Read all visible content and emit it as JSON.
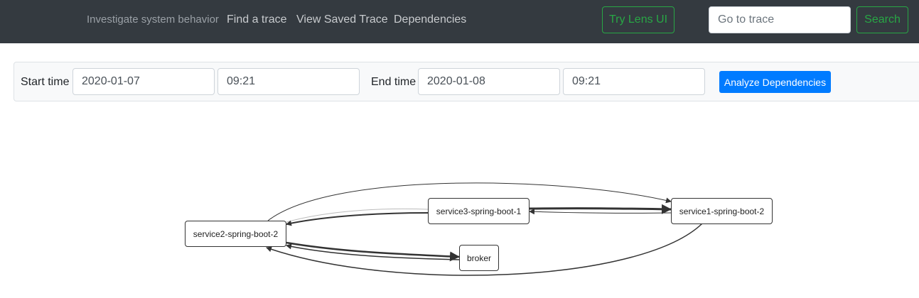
{
  "navbar": {
    "tagline": "Investigate system behavior",
    "links": [
      "Find a trace",
      "View Saved Trace",
      "Dependencies"
    ],
    "lens_button": "Try Lens UI",
    "goto_placeholder": "Go to trace",
    "search_button": "Search"
  },
  "filters": {
    "start_label": "Start time",
    "start_date": "2020-01-07",
    "start_time": "09:21",
    "end_label": "End time",
    "end_date": "2020-01-08",
    "end_time": "09:21",
    "analyze_button": "Analyze Dependencies"
  },
  "graph": {
    "nodes": [
      "service2-spring-boot-2",
      "service3-spring-boot-1",
      "service1-spring-boot-2",
      "broker"
    ],
    "edges": [
      [
        "service2-spring-boot-2",
        "service1-spring-boot-2"
      ],
      [
        "service3-spring-boot-1",
        "service2-spring-boot-2"
      ],
      [
        "service3-spring-boot-1",
        "service1-spring-boot-2"
      ],
      [
        "service1-spring-boot-2",
        "service3-spring-boot-1"
      ],
      [
        "service2-spring-boot-2",
        "broker"
      ],
      [
        "broker",
        "service2-spring-boot-2"
      ],
      [
        "service1-spring-boot-2",
        "service2-spring-boot-2"
      ]
    ]
  }
}
